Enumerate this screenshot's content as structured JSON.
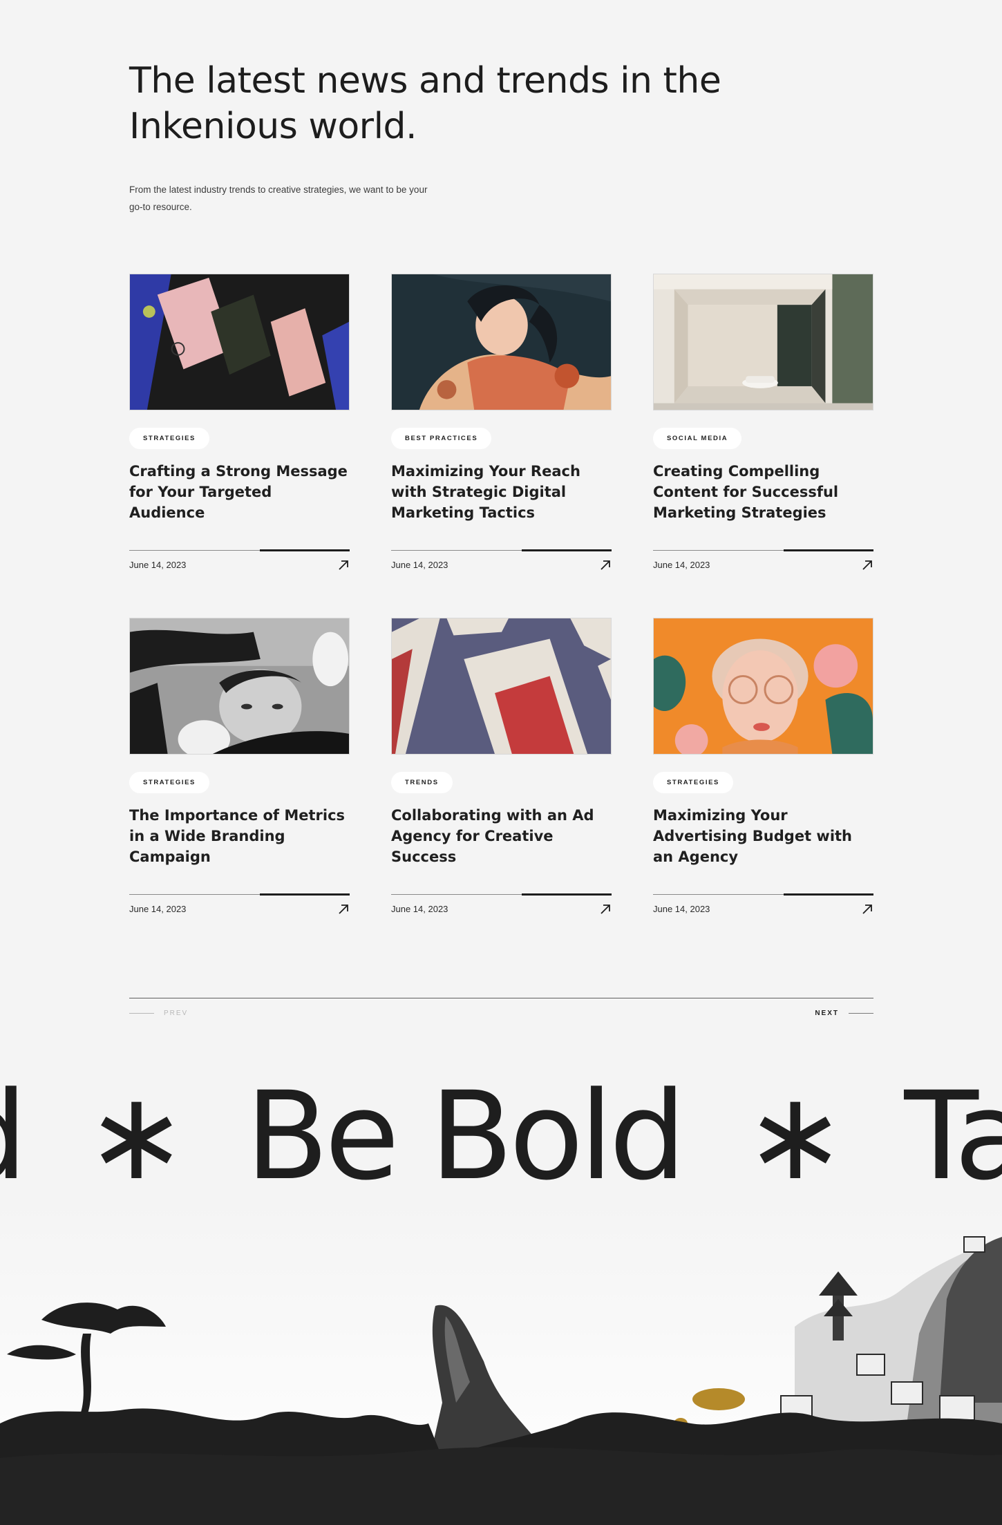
{
  "hero": {
    "heading": "The latest news and trends in the Inkenious world.",
    "intro": "From the latest industry trends to creative strategies, we want to be your go-to resource."
  },
  "posts": [
    {
      "tag": "STRATEGIES",
      "title": "Crafting a Strong Message for Your Targeted Audience",
      "date": "June 14, 2023",
      "image": "business-cards-mockup"
    },
    {
      "tag": "BEST PRACTICES",
      "title": "Maximizing Your Reach with Strategic Digital Marketing Tactics",
      "date": "June 14, 2023",
      "image": "illustrated-woman-portrait"
    },
    {
      "tag": "SOCIAL MEDIA",
      "title": "Creating Compelling Content for Successful Marketing Strategies",
      "date": "June 14, 2023",
      "image": "modern-garage-car"
    },
    {
      "tag": "STRATEGIES",
      "title": "The Importance of Metrics in a Wide Branding Campaign",
      "date": "June 14, 2023",
      "image": "bw-man-with-discs"
    },
    {
      "tag": "TRENDS",
      "title": "Collaborating with an Ad Agency for Creative Success",
      "date": "June 14, 2023",
      "image": "book-covers-mockup"
    },
    {
      "tag": "STRATEGIES",
      "title": "Maximizing Your Advertising Budget with an Agency",
      "date": "June 14, 2023",
      "image": "orange-portrait-glasses"
    }
  ],
  "pager": {
    "prev": "PREV",
    "next": "NEXT"
  },
  "marquee": {
    "word_left": "d",
    "star": "∗",
    "phrase": "Be Bold",
    "word_right": "Tak"
  },
  "colors": {
    "background": "#f4f4f4",
    "text": "#1f1f1f",
    "ink": "#1e1e1e"
  }
}
